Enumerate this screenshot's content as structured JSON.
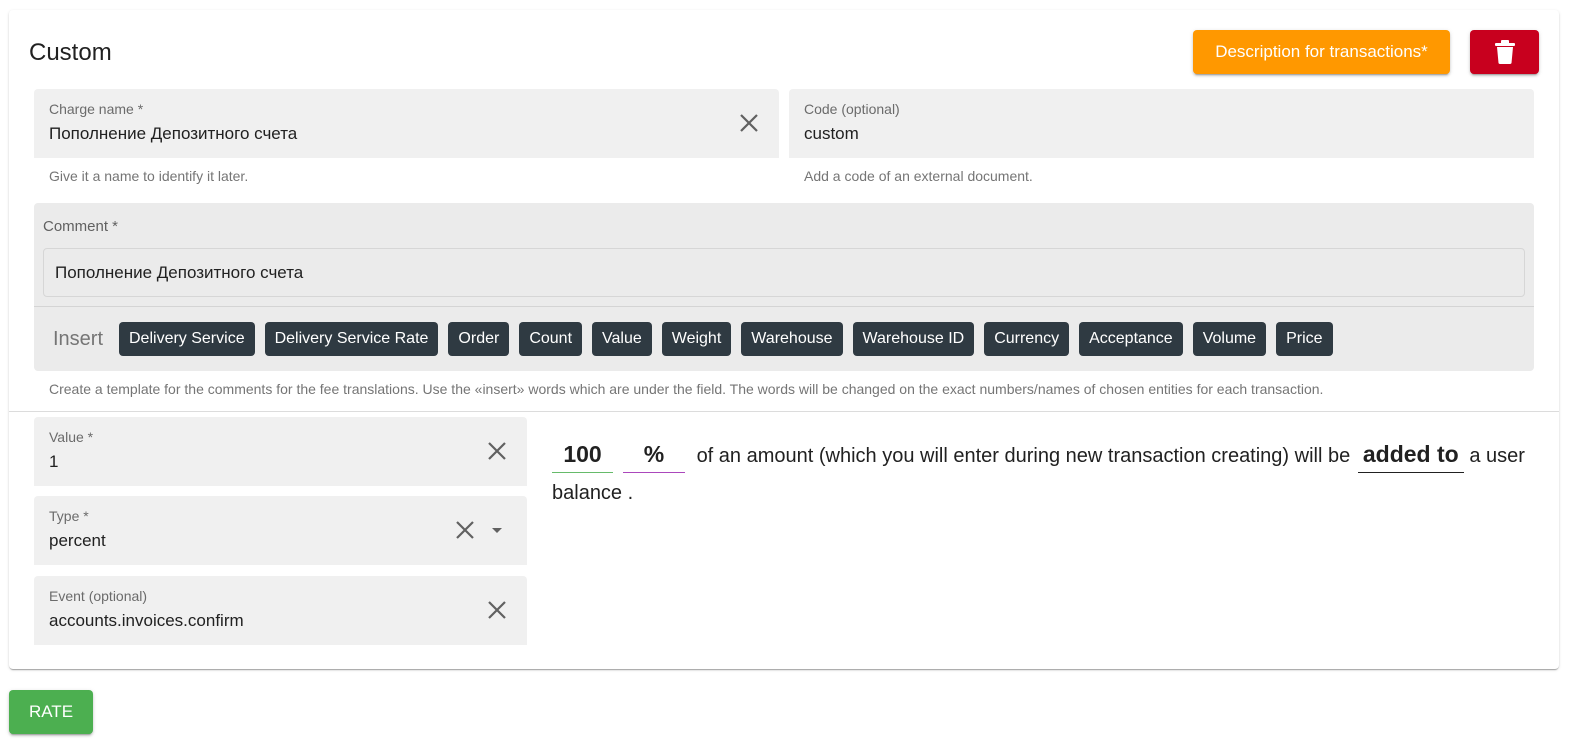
{
  "header": {
    "title": "Custom",
    "description_button": "Description for transactions*",
    "delete_icon": "trash-icon"
  },
  "charge_name": {
    "label": "Charge name *",
    "value": "Пополнение Депозитного счета",
    "hint": "Give it a name to identify it later."
  },
  "code": {
    "label": "Code (optional)",
    "value": "custom",
    "hint": "Add a code of an external document."
  },
  "comment": {
    "label": "Comment *",
    "value": "Пополнение Депозитного счета",
    "insert_label": "Insert",
    "chips": [
      "Delivery Service",
      "Delivery Service Rate",
      "Order",
      "Count",
      "Value",
      "Weight",
      "Warehouse",
      "Warehouse ID",
      "Currency",
      "Acceptance",
      "Volume",
      "Price"
    ],
    "hint": "Create a template for the comments for the fee translations. Use the «insert» words which are under the field. The words will be changed on the exact numbers/names of chosen entities for each transaction."
  },
  "value_field": {
    "label": "Value *",
    "value": "1"
  },
  "type_field": {
    "label": "Type *",
    "value": "percent"
  },
  "event_field": {
    "label": "Event (optional)",
    "value": "accounts.invoices.confirm"
  },
  "sentence": {
    "amount": "100",
    "unit": "%",
    "text1": "of an amount (which you will enter during new transaction creating) will be",
    "action": "added to",
    "text2": "a user balance ."
  },
  "rate_button": "RATE",
  "colors": {
    "orange": "#ff9800",
    "red": "#c8001e",
    "green": "#4caf50",
    "chip": "#2f3a42",
    "underline_green": "#66bb6a",
    "underline_purple": "#ab47bc"
  }
}
